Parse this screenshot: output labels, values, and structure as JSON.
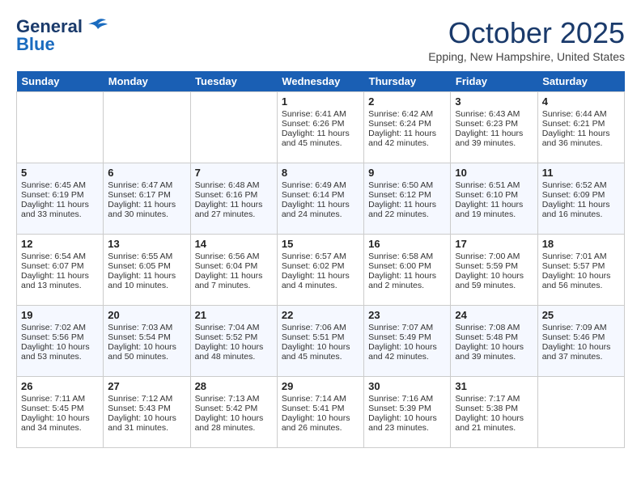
{
  "header": {
    "logo_general": "General",
    "logo_blue": "Blue",
    "month": "October 2025",
    "location": "Epping, New Hampshire, United States"
  },
  "days_of_week": [
    "Sunday",
    "Monday",
    "Tuesday",
    "Wednesday",
    "Thursday",
    "Friday",
    "Saturday"
  ],
  "weeks": [
    [
      {
        "day": "",
        "empty": true
      },
      {
        "day": "",
        "empty": true
      },
      {
        "day": "",
        "empty": true
      },
      {
        "day": "1",
        "sunrise": "Sunrise: 6:41 AM",
        "sunset": "Sunset: 6:26 PM",
        "daylight": "Daylight: 11 hours and 45 minutes."
      },
      {
        "day": "2",
        "sunrise": "Sunrise: 6:42 AM",
        "sunset": "Sunset: 6:24 PM",
        "daylight": "Daylight: 11 hours and 42 minutes."
      },
      {
        "day": "3",
        "sunrise": "Sunrise: 6:43 AM",
        "sunset": "Sunset: 6:23 PM",
        "daylight": "Daylight: 11 hours and 39 minutes."
      },
      {
        "day": "4",
        "sunrise": "Sunrise: 6:44 AM",
        "sunset": "Sunset: 6:21 PM",
        "daylight": "Daylight: 11 hours and 36 minutes."
      }
    ],
    [
      {
        "day": "5",
        "sunrise": "Sunrise: 6:45 AM",
        "sunset": "Sunset: 6:19 PM",
        "daylight": "Daylight: 11 hours and 33 minutes."
      },
      {
        "day": "6",
        "sunrise": "Sunrise: 6:47 AM",
        "sunset": "Sunset: 6:17 PM",
        "daylight": "Daylight: 11 hours and 30 minutes."
      },
      {
        "day": "7",
        "sunrise": "Sunrise: 6:48 AM",
        "sunset": "Sunset: 6:16 PM",
        "daylight": "Daylight: 11 hours and 27 minutes."
      },
      {
        "day": "8",
        "sunrise": "Sunrise: 6:49 AM",
        "sunset": "Sunset: 6:14 PM",
        "daylight": "Daylight: 11 hours and 24 minutes."
      },
      {
        "day": "9",
        "sunrise": "Sunrise: 6:50 AM",
        "sunset": "Sunset: 6:12 PM",
        "daylight": "Daylight: 11 hours and 22 minutes."
      },
      {
        "day": "10",
        "sunrise": "Sunrise: 6:51 AM",
        "sunset": "Sunset: 6:10 PM",
        "daylight": "Daylight: 11 hours and 19 minutes."
      },
      {
        "day": "11",
        "sunrise": "Sunrise: 6:52 AM",
        "sunset": "Sunset: 6:09 PM",
        "daylight": "Daylight: 11 hours and 16 minutes."
      }
    ],
    [
      {
        "day": "12",
        "sunrise": "Sunrise: 6:54 AM",
        "sunset": "Sunset: 6:07 PM",
        "daylight": "Daylight: 11 hours and 13 minutes."
      },
      {
        "day": "13",
        "sunrise": "Sunrise: 6:55 AM",
        "sunset": "Sunset: 6:05 PM",
        "daylight": "Daylight: 11 hours and 10 minutes."
      },
      {
        "day": "14",
        "sunrise": "Sunrise: 6:56 AM",
        "sunset": "Sunset: 6:04 PM",
        "daylight": "Daylight: 11 hours and 7 minutes."
      },
      {
        "day": "15",
        "sunrise": "Sunrise: 6:57 AM",
        "sunset": "Sunset: 6:02 PM",
        "daylight": "Daylight: 11 hours and 4 minutes."
      },
      {
        "day": "16",
        "sunrise": "Sunrise: 6:58 AM",
        "sunset": "Sunset: 6:00 PM",
        "daylight": "Daylight: 11 hours and 2 minutes."
      },
      {
        "day": "17",
        "sunrise": "Sunrise: 7:00 AM",
        "sunset": "Sunset: 5:59 PM",
        "daylight": "Daylight: 10 hours and 59 minutes."
      },
      {
        "day": "18",
        "sunrise": "Sunrise: 7:01 AM",
        "sunset": "Sunset: 5:57 PM",
        "daylight": "Daylight: 10 hours and 56 minutes."
      }
    ],
    [
      {
        "day": "19",
        "sunrise": "Sunrise: 7:02 AM",
        "sunset": "Sunset: 5:56 PM",
        "daylight": "Daylight: 10 hours and 53 minutes."
      },
      {
        "day": "20",
        "sunrise": "Sunrise: 7:03 AM",
        "sunset": "Sunset: 5:54 PM",
        "daylight": "Daylight: 10 hours and 50 minutes."
      },
      {
        "day": "21",
        "sunrise": "Sunrise: 7:04 AM",
        "sunset": "Sunset: 5:52 PM",
        "daylight": "Daylight: 10 hours and 48 minutes."
      },
      {
        "day": "22",
        "sunrise": "Sunrise: 7:06 AM",
        "sunset": "Sunset: 5:51 PM",
        "daylight": "Daylight: 10 hours and 45 minutes."
      },
      {
        "day": "23",
        "sunrise": "Sunrise: 7:07 AM",
        "sunset": "Sunset: 5:49 PM",
        "daylight": "Daylight: 10 hours and 42 minutes."
      },
      {
        "day": "24",
        "sunrise": "Sunrise: 7:08 AM",
        "sunset": "Sunset: 5:48 PM",
        "daylight": "Daylight: 10 hours and 39 minutes."
      },
      {
        "day": "25",
        "sunrise": "Sunrise: 7:09 AM",
        "sunset": "Sunset: 5:46 PM",
        "daylight": "Daylight: 10 hours and 37 minutes."
      }
    ],
    [
      {
        "day": "26",
        "sunrise": "Sunrise: 7:11 AM",
        "sunset": "Sunset: 5:45 PM",
        "daylight": "Daylight: 10 hours and 34 minutes."
      },
      {
        "day": "27",
        "sunrise": "Sunrise: 7:12 AM",
        "sunset": "Sunset: 5:43 PM",
        "daylight": "Daylight: 10 hours and 31 minutes."
      },
      {
        "day": "28",
        "sunrise": "Sunrise: 7:13 AM",
        "sunset": "Sunset: 5:42 PM",
        "daylight": "Daylight: 10 hours and 28 minutes."
      },
      {
        "day": "29",
        "sunrise": "Sunrise: 7:14 AM",
        "sunset": "Sunset: 5:41 PM",
        "daylight": "Daylight: 10 hours and 26 minutes."
      },
      {
        "day": "30",
        "sunrise": "Sunrise: 7:16 AM",
        "sunset": "Sunset: 5:39 PM",
        "daylight": "Daylight: 10 hours and 23 minutes."
      },
      {
        "day": "31",
        "sunrise": "Sunrise: 7:17 AM",
        "sunset": "Sunset: 5:38 PM",
        "daylight": "Daylight: 10 hours and 21 minutes."
      },
      {
        "day": "",
        "empty": true
      }
    ]
  ]
}
